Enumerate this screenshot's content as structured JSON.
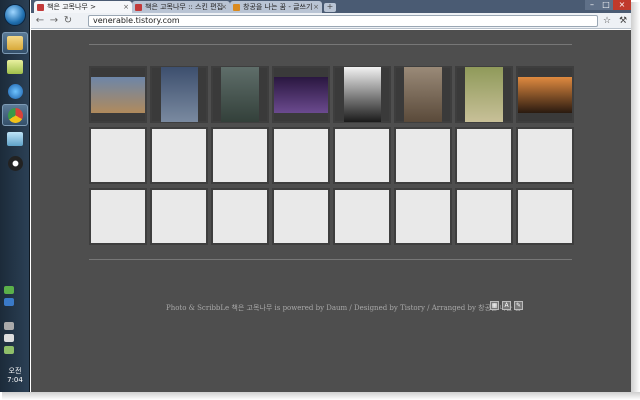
{
  "browser": {
    "tabs": [
      {
        "title": "책은 고목나무 >",
        "active": true,
        "favicon_color": "#c23a3a"
      },
      {
        "title": "책은 고목나무 :: 스킨 편집",
        "active": false,
        "favicon_color": "#c23a3a"
      },
      {
        "title": "창공을 나는 꿈 - 글쓰기",
        "active": false,
        "favicon_color": "#d98a1f"
      }
    ],
    "new_tab_label": "+",
    "address": "venerable.tistory.com",
    "star_icon": "star-icon",
    "wrench_icon": "wrench-icon"
  },
  "taskbar": {
    "icons": [
      "start-orb",
      "folder-icon",
      "folder-icon",
      "ie-icon",
      "chrome-icon",
      "window-icon",
      "media-player-icon"
    ],
    "clock": "오전 7:04"
  },
  "gallery": {
    "photos": [
      {
        "name": "desert-ruins-photo",
        "colors": [
          "#6d86a8",
          "#b08a5c"
        ]
      },
      {
        "name": "city-street-photo",
        "colors": [
          "#3d4f6e",
          "#7a8aa0"
        ]
      },
      {
        "name": "subway-interior-photo",
        "colors": [
          "#5f6e6a",
          "#33403a"
        ]
      },
      {
        "name": "night-lightning-photo",
        "colors": [
          "#2a1740",
          "#6b4a8f"
        ]
      },
      {
        "name": "bw-portrait-photo",
        "colors": [
          "#f2f2f2",
          "#1a1a1a"
        ]
      },
      {
        "name": "shadow-on-leaves-photo",
        "colors": [
          "#9a8a78",
          "#5a4a3a"
        ]
      },
      {
        "name": "market-hall-photo",
        "colors": [
          "#8f9a5a",
          "#c8c098"
        ]
      },
      {
        "name": "sunset-silhouette-photo",
        "colors": [
          "#e08a40",
          "#2a1a10"
        ]
      }
    ],
    "empty_rows": 2
  },
  "footer": {
    "text": "Photo & ScribbLe 책은 고목나무 is powered by Daum / Designed by Tistory / Arranged by 창공을 나는 꿈"
  },
  "colors": {
    "page_bg": "#4e4e4e",
    "tile_empty": "#e9e9e9"
  }
}
